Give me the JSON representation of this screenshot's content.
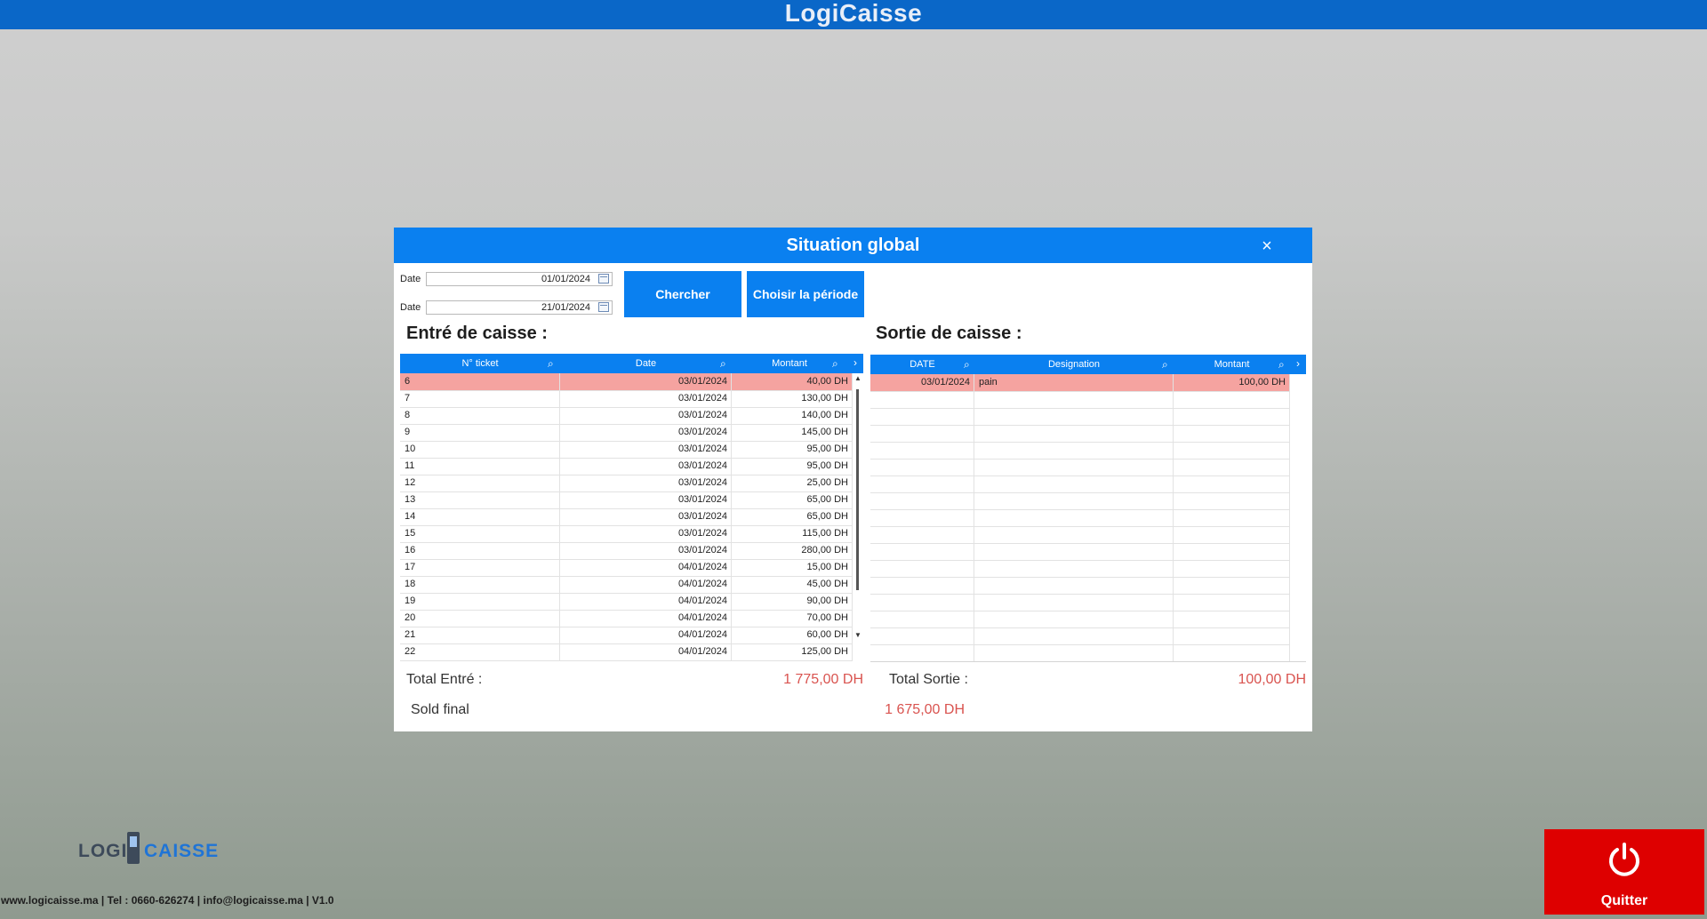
{
  "app": {
    "title": "LogiCaisse"
  },
  "dialog": {
    "title": "Situation global",
    "close_icon": "×",
    "date_label_1": "Date",
    "date_value_1": "01/01/2024",
    "date_label_2": "Date",
    "date_value_2": "21/01/2024",
    "search_button": "Chercher",
    "period_button": "Choisir la période"
  },
  "entree": {
    "title": "Entré de caisse :",
    "columns": [
      "N° ticket",
      "Date",
      "Montant"
    ],
    "rows": [
      {
        "ticket": "6",
        "date": "03/01/2024",
        "montant": "40,00 DH"
      },
      {
        "ticket": "7",
        "date": "03/01/2024",
        "montant": "130,00 DH"
      },
      {
        "ticket": "8",
        "date": "03/01/2024",
        "montant": "140,00 DH"
      },
      {
        "ticket": "9",
        "date": "03/01/2024",
        "montant": "145,00 DH"
      },
      {
        "ticket": "10",
        "date": "03/01/2024",
        "montant": "95,00 DH"
      },
      {
        "ticket": "11",
        "date": "03/01/2024",
        "montant": "95,00 DH"
      },
      {
        "ticket": "12",
        "date": "03/01/2024",
        "montant": "25,00 DH"
      },
      {
        "ticket": "13",
        "date": "03/01/2024",
        "montant": "65,00 DH"
      },
      {
        "ticket": "14",
        "date": "03/01/2024",
        "montant": "65,00 DH"
      },
      {
        "ticket": "15",
        "date": "03/01/2024",
        "montant": "115,00 DH"
      },
      {
        "ticket": "16",
        "date": "03/01/2024",
        "montant": "280,00 DH"
      },
      {
        "ticket": "17",
        "date": "04/01/2024",
        "montant": "15,00 DH"
      },
      {
        "ticket": "18",
        "date": "04/01/2024",
        "montant": "45,00 DH"
      },
      {
        "ticket": "19",
        "date": "04/01/2024",
        "montant": "90,00 DH"
      },
      {
        "ticket": "20",
        "date": "04/01/2024",
        "montant": "70,00 DH"
      },
      {
        "ticket": "21",
        "date": "04/01/2024",
        "montant": "60,00 DH"
      },
      {
        "ticket": "22",
        "date": "04/01/2024",
        "montant": "125,00 DH"
      }
    ],
    "total_label": "Total Entré  :",
    "total_value": "1 775,00 DH"
  },
  "sortie": {
    "title": "Sortie de caisse :",
    "columns": [
      "DATE",
      "Designation",
      "Montant"
    ],
    "rows": [
      {
        "date": "03/01/2024",
        "designation": "pain",
        "montant": "100,00 DH"
      }
    ],
    "total_label": "Total Sortie :",
    "total_value": "100,00 DH"
  },
  "sold": {
    "label": "Sold final",
    "value": "1 675,00 DH"
  },
  "footer": {
    "logo_left": "LOGI",
    "logo_right": "CAISSE",
    "info": "www.logicaisse.ma | Tel : 0660-626274 | info@logicaisse.ma | V1.0",
    "quit_label": "Quitter"
  },
  "colors": {
    "accent": "#0a80f0",
    "titlebar": "#0a67c8",
    "selected_row": "#f5a3a0",
    "amount": "#d9534f",
    "quit": "#de0000"
  },
  "icons": {
    "search": "magnifier-icon",
    "calendar": "calendar-icon",
    "power": "power-icon",
    "close": "close-icon"
  }
}
